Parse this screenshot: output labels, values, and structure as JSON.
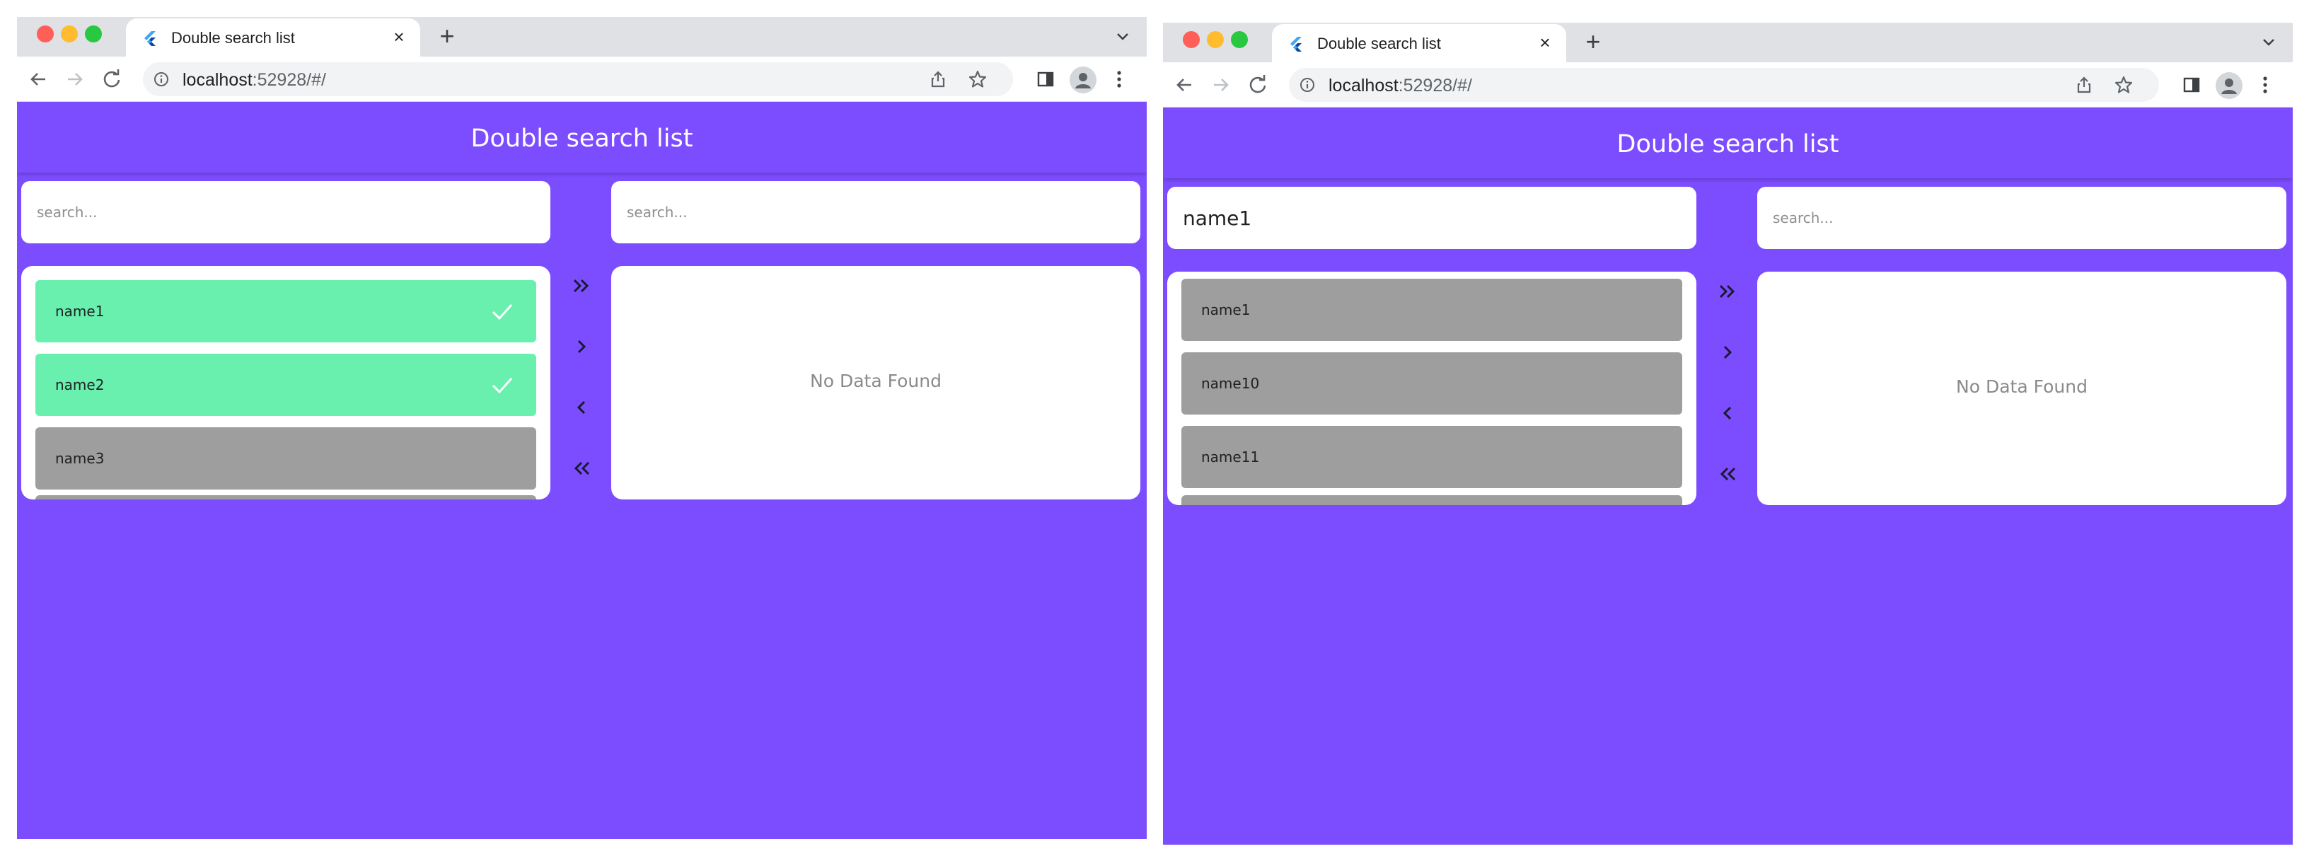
{
  "colors": {
    "app_background": "#7c4dff",
    "selected_item": "#69f0ae",
    "unselected_item": "#9e9e9e"
  },
  "windows": [
    {
      "tab_title": "Double search list",
      "url_host": "localhost",
      "url_path": ":52928/#/",
      "app_title": "Double search list",
      "left_search": {
        "value": "",
        "placeholder": "search..."
      },
      "right_search": {
        "value": "",
        "placeholder": "search..."
      },
      "left_list": [
        {
          "label": "name1",
          "selected": true
        },
        {
          "label": "name2",
          "selected": true
        },
        {
          "label": "name3",
          "selected": false
        }
      ],
      "right_empty_text": "No Data Found",
      "icons": {
        "move_all_right": "double-chevron-right-icon",
        "move_right": "chevron-right-icon",
        "move_left": "chevron-left-icon",
        "move_all_left": "double-chevron-left-icon",
        "selected": "check-icon"
      }
    },
    {
      "tab_title": "Double search list",
      "url_host": "localhost",
      "url_path": ":52928/#/",
      "app_title": "Double search list",
      "left_search": {
        "value": "name1",
        "placeholder": "search..."
      },
      "right_search": {
        "value": "",
        "placeholder": "search..."
      },
      "left_list": [
        {
          "label": "name1",
          "selected": false
        },
        {
          "label": "name10",
          "selected": false
        },
        {
          "label": "name11",
          "selected": false
        }
      ],
      "right_empty_text": "No Data Found",
      "icons": {
        "move_all_right": "double-chevron-right-icon",
        "move_right": "chevron-right-icon",
        "move_left": "chevron-left-icon",
        "move_all_left": "double-chevron-left-icon",
        "selected": "check-icon"
      }
    }
  ]
}
